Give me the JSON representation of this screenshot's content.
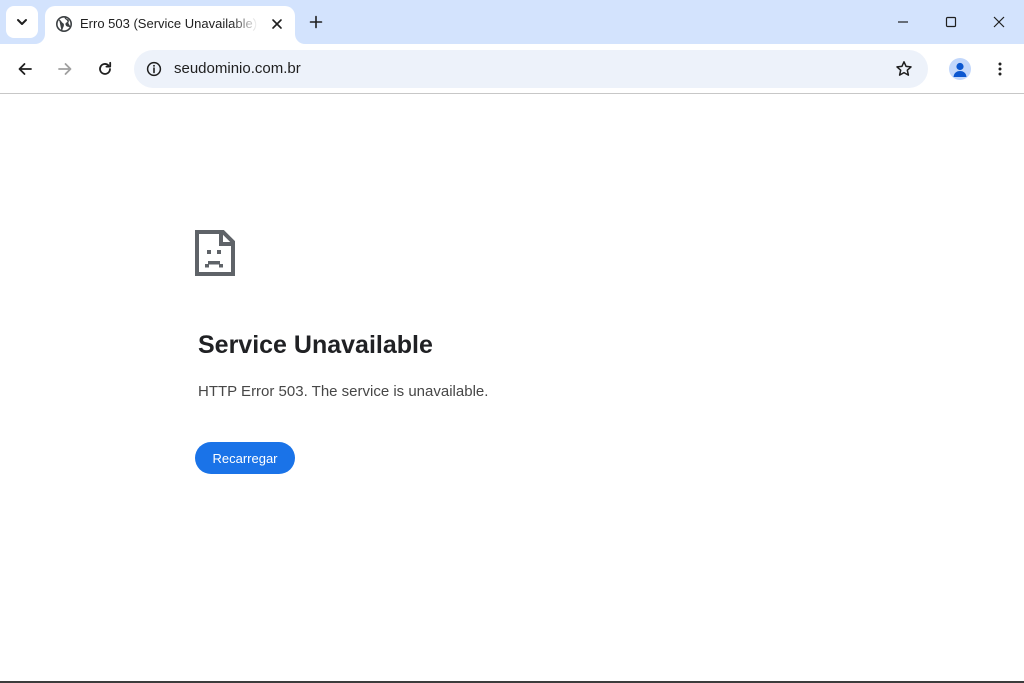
{
  "colors": {
    "tabstrip_bg": "#d3e3fd",
    "omnibox_bg": "#edf2fa",
    "accent": "#1a73e8",
    "text_primary": "#202124",
    "text_secondary": "#474747"
  },
  "tabstrip": {
    "search_tabs_icon": "chevron-down-icon",
    "tab": {
      "favicon": "globe-icon",
      "title": "Erro 503 (Service Unavailable)",
      "close_icon": "close-icon"
    },
    "new_tab_icon": "plus-icon",
    "window_controls": [
      "minimize-icon",
      "maximize-icon",
      "close-window-icon"
    ]
  },
  "toolbar": {
    "back_icon": "back-arrow-icon",
    "forward_icon": "forward-arrow-icon",
    "reload_icon": "reload-icon",
    "site_info_icon": "info-icon",
    "url": "seudominio.com.br",
    "bookmark_icon": "star-icon",
    "profile_icon": "person-icon",
    "menu_icon": "kebab-menu-icon"
  },
  "error_page": {
    "icon": "sad-document-icon",
    "title": "Service Unavailable",
    "description": "HTTP Error 503. The service is unavailable.",
    "reload_label": "Recarregar"
  }
}
